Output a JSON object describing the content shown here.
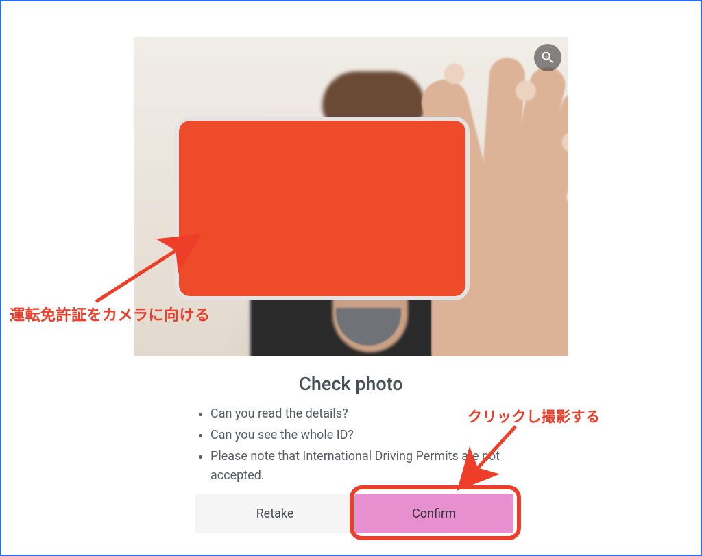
{
  "title": "Check photo",
  "checklist": {
    "item1": "Can you read the details?",
    "item2": "Can you see the whole ID?",
    "item3": "Please note that International Driving Permits are not accepted."
  },
  "buttons": {
    "retake": "Retake",
    "confirm": "Confirm"
  },
  "annotations": {
    "point_camera": "運転免許証をカメラに向ける",
    "click_to_capture": "クリックし撮影する"
  },
  "icons": {
    "zoom": "zoom-in-icon"
  },
  "colors": {
    "accent_red": "#ee3d28",
    "redaction": "#ee4b2b",
    "confirm_bg": "#e88fd0",
    "retake_bg": "#f5f5f5",
    "frame_border": "#2a6cf6"
  }
}
